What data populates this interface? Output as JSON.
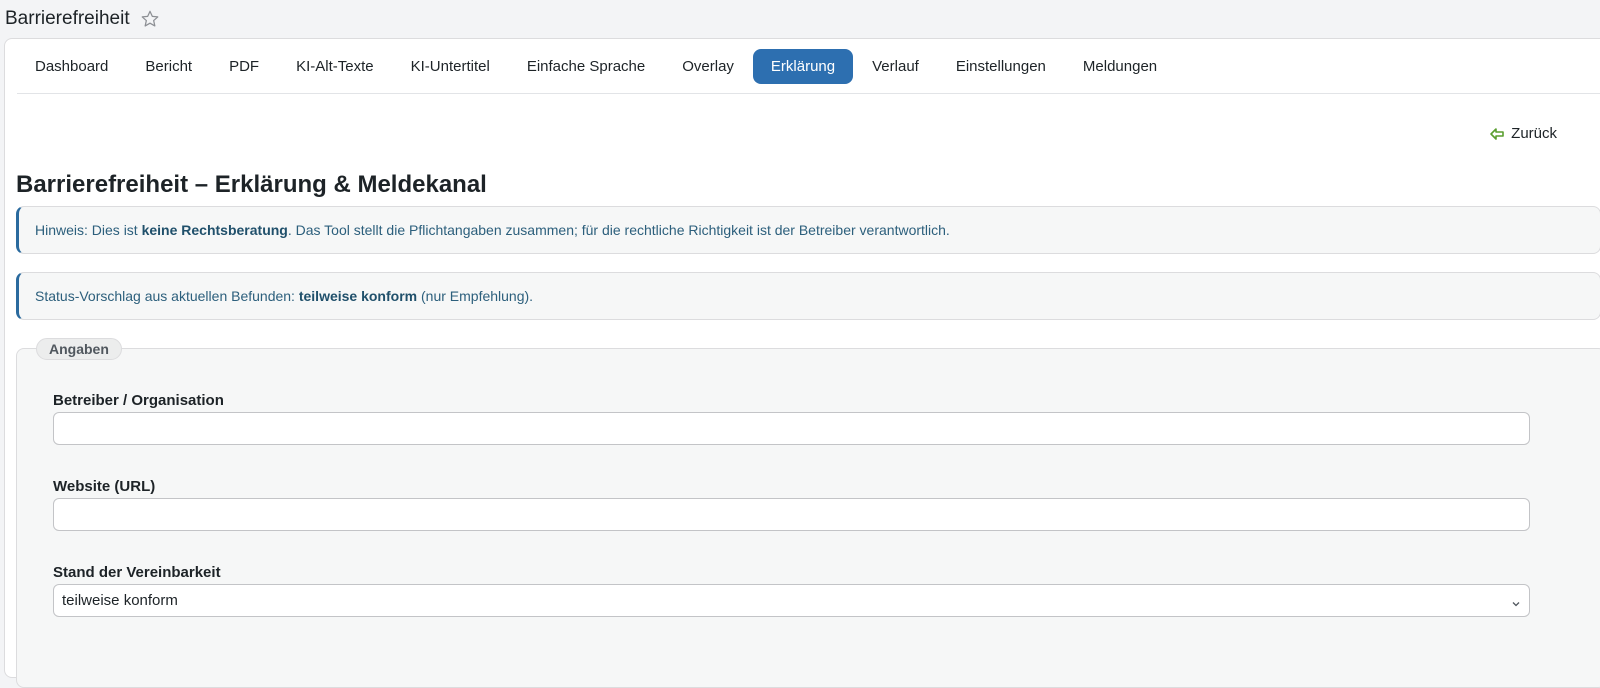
{
  "header": {
    "title": "Barrierefreiheit"
  },
  "tabs": [
    {
      "label": "Dashboard"
    },
    {
      "label": "Bericht"
    },
    {
      "label": "PDF"
    },
    {
      "label": "KI-Alt-Texte"
    },
    {
      "label": "KI-Untertitel"
    },
    {
      "label": "Einfache Sprache"
    },
    {
      "label": "Overlay"
    },
    {
      "label": "Erklärung",
      "active": true
    },
    {
      "label": "Verlauf"
    },
    {
      "label": "Einstellungen"
    },
    {
      "label": "Meldungen"
    }
  ],
  "back_link": {
    "label": "Zurück"
  },
  "page": {
    "title": "Barrierefreiheit – Erklärung & Meldekanal"
  },
  "notices": {
    "legal": {
      "prefix": "Hinweis: Dies ist ",
      "strong": "keine Rechtsberatung",
      "suffix": ". Das Tool stellt die Pflichtangaben zusammen; für die rechtliche Richtigkeit ist der Betreiber verantwortlich."
    },
    "status": {
      "prefix": "Status-Vorschlag aus aktuellen Befunden: ",
      "strong": "teilweise konform",
      "suffix": " (nur Empfehlung)."
    }
  },
  "form": {
    "legend": "Angaben",
    "operator": {
      "label": "Betreiber / Organisation",
      "value": "",
      "placeholder": ""
    },
    "website": {
      "label": "Website (URL)",
      "value": "",
      "placeholder": ""
    },
    "compliance": {
      "label": "Stand der Vereinbarkeit",
      "value": "teilweise konform"
    }
  },
  "colors": {
    "accent": "#2d6fb0",
    "back_icon": "#5a9e2f",
    "notice_border": "#2a6a9e"
  },
  "icons": {
    "favorite": "star-icon",
    "back": "back-arrow-icon",
    "select": "chevron-down-icon"
  }
}
